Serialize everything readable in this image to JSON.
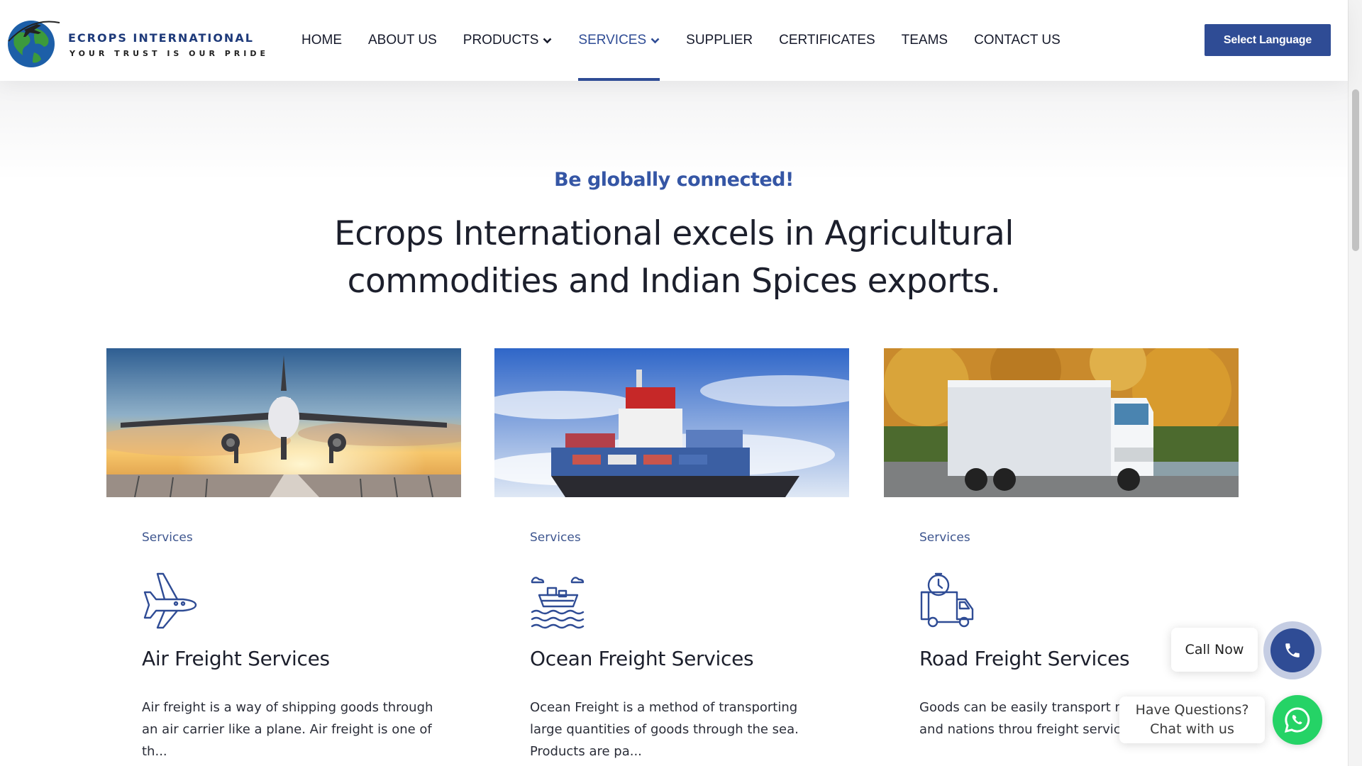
{
  "header": {
    "logo_name": "ECROPS INTERNATIONAL",
    "logo_tagline": "YOUR TRUST IS OUR PRIDE",
    "nav": [
      {
        "label": "HOME"
      },
      {
        "label": "ABOUT US"
      },
      {
        "label": "PRODUCTS"
      },
      {
        "label": "SERVICES"
      },
      {
        "label": "SUPPLIER"
      },
      {
        "label": "CERTIFICATES"
      },
      {
        "label": "TEAMS"
      },
      {
        "label": "CONTACT US"
      }
    ],
    "active_nav": "SERVICES",
    "language_button": "Select Language"
  },
  "hero": {
    "tagline": "Be globally connected!",
    "headline": "Ecrops International excels in Agricultural commodities and Indian Spices exports."
  },
  "cards": [
    {
      "category": "Services",
      "icon": "airplane-icon",
      "title": "Air Freight Services",
      "text": "Air freight is a way of shipping goods through an air carrier like a plane. Air freight is one of th..."
    },
    {
      "category": "Services",
      "icon": "cargo-ship-icon",
      "title": "Ocean Freight Services",
      "text": "Ocean Freight is a method of transporting large quantities of goods through the sea. Products are pa..."
    },
    {
      "category": "Services",
      "icon": "delivery-truck-icon",
      "title": "Road Freight Services",
      "text": "Goods can be easily transport many states and nations throu freight service...."
    }
  ],
  "widgets": {
    "call_label": "Call Now",
    "chat_line1": "Have Questions?",
    "chat_line2": "Chat with us"
  },
  "colors": {
    "brand_blue": "#2f4c95",
    "whatsapp_green": "#25d366"
  }
}
